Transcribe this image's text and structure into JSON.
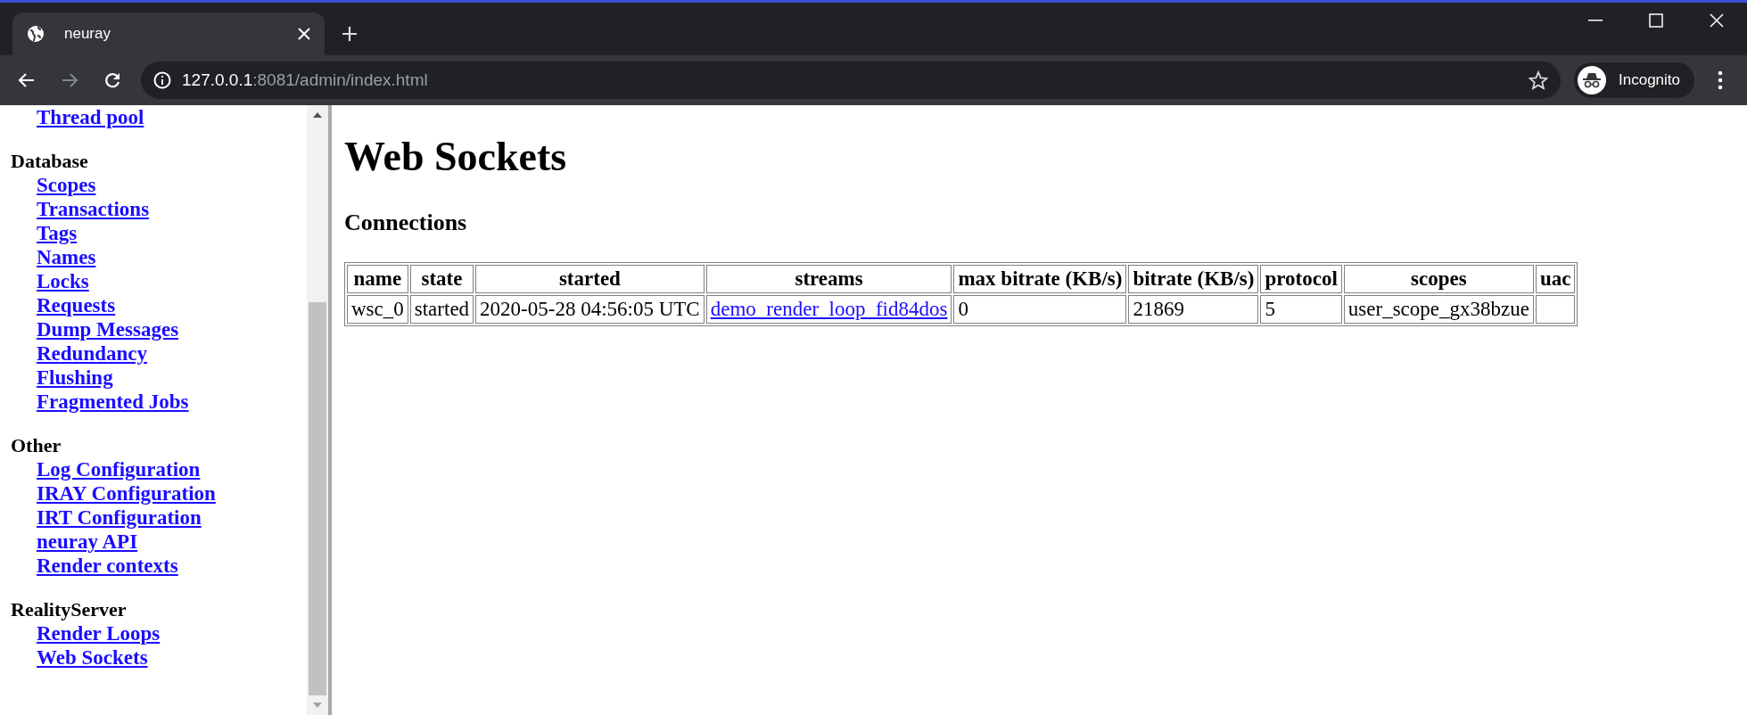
{
  "browser": {
    "tab": {
      "title": "neuray",
      "selected": true
    },
    "address": {
      "host": "127.0.0.1",
      "path": ":8081/admin/index.html"
    },
    "forward_disabled": true,
    "profile": {
      "label": "Incognito"
    }
  },
  "sidebar": {
    "groups": [
      {
        "links": [
          "Thread pool"
        ]
      },
      {
        "heading": "Database",
        "links": [
          "Scopes",
          "Transactions",
          "Tags",
          "Names",
          "Locks",
          "Requests",
          "Dump Messages",
          "Redundancy",
          "Flushing",
          "Fragmented Jobs"
        ]
      },
      {
        "heading": "Other",
        "links": [
          "Log Configuration",
          "IRAY Configuration",
          "IRT Configuration",
          "neuray API",
          "Render contexts"
        ]
      },
      {
        "heading": "RealityServer",
        "links": [
          "Render Loops",
          "Web Sockets"
        ]
      }
    ]
  },
  "page": {
    "title": "Web Sockets",
    "section": "Connections"
  },
  "table": {
    "columns": [
      {
        "label": "name",
        "kind": "text"
      },
      {
        "label": "state",
        "kind": "text"
      },
      {
        "label": "started",
        "kind": "text"
      },
      {
        "label": "streams",
        "kind": "link"
      },
      {
        "label": "max bitrate (KB/s)",
        "kind": "text"
      },
      {
        "label": "bitrate (KB/s)",
        "kind": "text"
      },
      {
        "label": "protocol",
        "kind": "text"
      },
      {
        "label": "scopes",
        "kind": "text"
      },
      {
        "label": "uac",
        "kind": "text"
      }
    ],
    "rows": [
      {
        "cells": [
          "wsc_0",
          "started",
          "2020-05-28 04:56:05 UTC",
          "demo_render_loop_fid84dos",
          "0",
          "21869",
          "5",
          "user_scope_gx38bzue"
        ]
      }
    ]
  }
}
